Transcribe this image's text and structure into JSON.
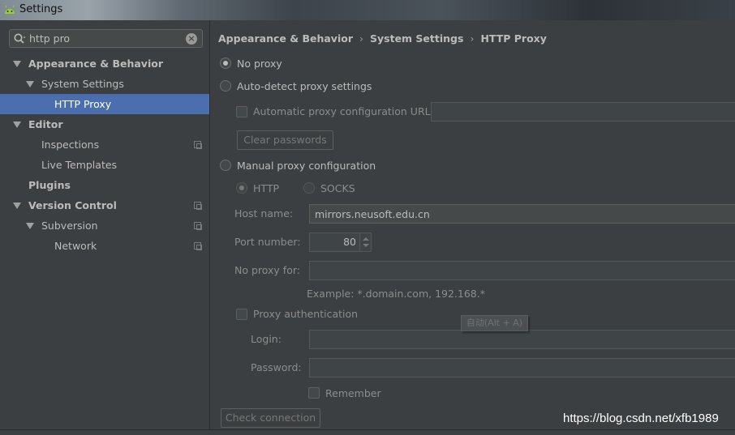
{
  "window": {
    "title": "Settings",
    "icon": "android-icon"
  },
  "search": {
    "value": "http pro",
    "placeholder": ""
  },
  "tree": [
    {
      "label": "Appearance & Behavior",
      "level": 0,
      "expanded": true,
      "bold": true
    },
    {
      "label": "System Settings",
      "level": 1,
      "expanded": true,
      "bold": false
    },
    {
      "label": "HTTP Proxy",
      "level": 2,
      "selected": true,
      "bold": false
    },
    {
      "label": "Editor",
      "level": 0,
      "expanded": true,
      "bold": true
    },
    {
      "label": "Inspections",
      "level": 1,
      "bold": false,
      "copy": true
    },
    {
      "label": "Live Templates",
      "level": 1,
      "bold": false
    },
    {
      "label": "Plugins",
      "level": 0,
      "bold": true
    },
    {
      "label": "Version Control",
      "level": 0,
      "expanded": true,
      "bold": true,
      "copy": true
    },
    {
      "label": "Subversion",
      "level": 1,
      "expanded": true,
      "bold": false,
      "copy": true
    },
    {
      "label": "Network",
      "level": 2,
      "bold": false,
      "copy": true
    }
  ],
  "breadcrumb": [
    "Appearance & Behavior",
    "System Settings",
    "HTTP Proxy"
  ],
  "proxy": {
    "no_proxy": "No proxy",
    "auto_detect": "Auto-detect proxy settings",
    "auto_config_url": "Automatic proxy configuration URL:",
    "auto_config_url_value": "",
    "clear_passwords": "Clear passwords",
    "manual": "Manual proxy configuration",
    "http": "HTTP",
    "socks": "SOCKS",
    "host_name_label": "Host name:",
    "host_name_value": "mirrors.neusoft.edu.cn",
    "port_label": "Port number:",
    "port_value": "80",
    "no_proxy_for_label": "No proxy for:",
    "no_proxy_for_value": "",
    "example": "Example: *.domain.com, 192.168.*",
    "proxy_auth": "Proxy authentication",
    "login_label": "Login:",
    "login_value": "",
    "password_label": "Password:",
    "password_value": "",
    "remember": "Remember",
    "check_connection": "Check connection"
  },
  "tooltip": "自动(Alt + A)",
  "watermark": "https://blog.csdn.net/xfb1989",
  "colors": {
    "selection": "#4b6eaf",
    "background": "#3c3f41"
  }
}
